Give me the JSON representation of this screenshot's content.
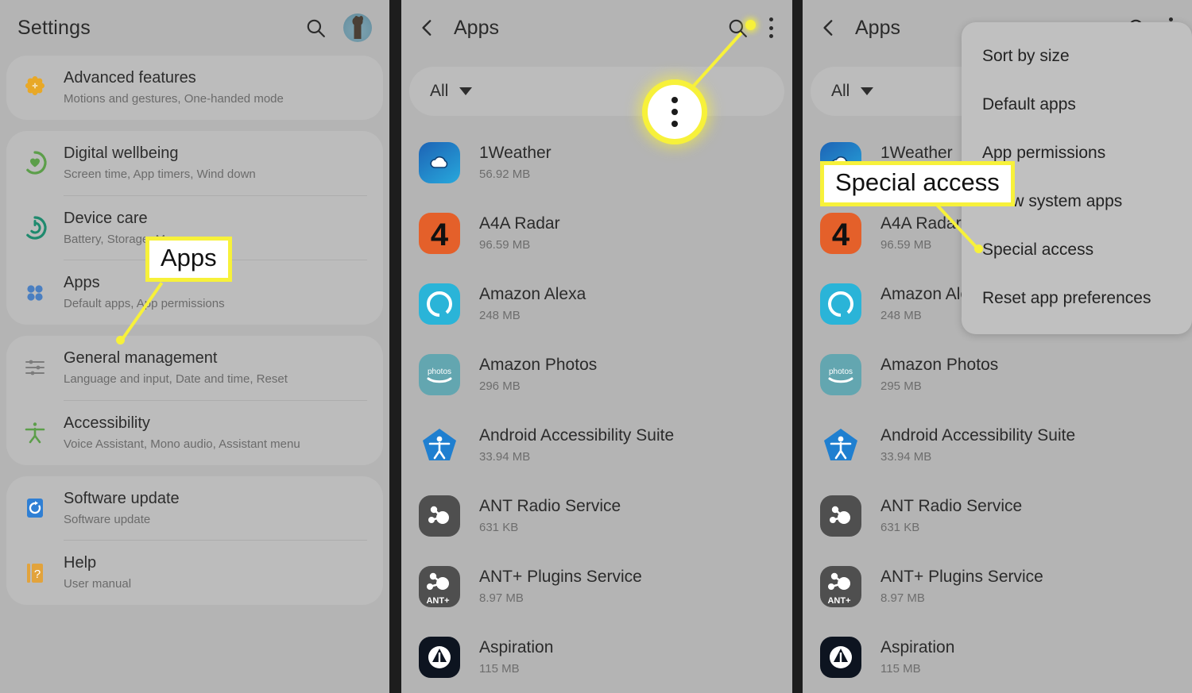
{
  "panels": {
    "settings": {
      "title": "Settings",
      "icons": {
        "search": "search-icon",
        "avatar": "avatar-giraffe"
      },
      "groups": [
        {
          "items": [
            {
              "title": "Advanced features",
              "subtitle": "Motions and gestures, One-handed mode",
              "icon": "advanced-features-icon",
              "color": "#e8a827"
            }
          ]
        },
        {
          "items": [
            {
              "title": "Digital wellbeing",
              "subtitle": "Screen time, App timers, Wind down",
              "icon": "digital-wellbeing-icon",
              "color": "#5c9e4a"
            },
            {
              "title": "Device care",
              "subtitle": "Battery, Storage, Memory",
              "icon": "device-care-icon",
              "color": "#1f8a6e"
            },
            {
              "title": "Apps",
              "subtitle": "Default apps, App permissions",
              "icon": "apps-icon",
              "color": "#4a7fc1"
            }
          ]
        },
        {
          "items": [
            {
              "title": "General management",
              "subtitle": "Language and input, Date and time, Reset",
              "icon": "sliders-icon",
              "color": "#787878"
            },
            {
              "title": "Accessibility",
              "subtitle": "Voice Assistant, Mono audio, Assistant menu",
              "icon": "accessibility-icon",
              "color": "#5c9e4a"
            }
          ]
        },
        {
          "items": [
            {
              "title": "Software update",
              "subtitle": "Software update",
              "icon": "software-update-icon",
              "color": "#2f7fd4"
            },
            {
              "title": "Help",
              "subtitle": "User manual",
              "icon": "help-icon",
              "color": "#e2a33c"
            }
          ]
        }
      ]
    },
    "apps_middle": {
      "title": "Apps",
      "back_icon": "back-chevron-icon",
      "search_icon": "search-icon",
      "menu_icon": "kebab-menu-icon",
      "filter_label": "All",
      "filter_caret": "chevron-down-icon",
      "apps": [
        {
          "name": "1Weather",
          "size": "56.92 MB",
          "icon": "weather-cloud-icon"
        },
        {
          "name": "A4A Radar",
          "size": "96.59 MB",
          "icon": "a4a-radar-icon"
        },
        {
          "name": "Amazon Alexa",
          "size": "248 MB",
          "icon": "alexa-icon"
        },
        {
          "name": "Amazon Photos",
          "size": "296 MB",
          "icon": "amazon-photos-icon"
        },
        {
          "name": "Android Accessibility Suite",
          "size": "33.94 MB",
          "icon": "accessibility-suite-icon"
        },
        {
          "name": "ANT Radio Service",
          "size": "631 KB",
          "icon": "ant-radio-icon"
        },
        {
          "name": "ANT+ Plugins Service",
          "size": "8.97 MB",
          "icon": "ant-plus-icon"
        },
        {
          "name": "Aspiration",
          "size": "115 MB",
          "icon": "aspiration-icon"
        }
      ]
    },
    "apps_right": {
      "title": "Apps",
      "back_icon": "back-chevron-icon",
      "search_icon": "search-icon",
      "menu_icon": "kebab-menu-icon",
      "filter_label": "All",
      "filter_caret": "chevron-down-icon",
      "apps": [
        {
          "name": "1Weather",
          "size": "56.92 MB",
          "icon": "weather-cloud-icon"
        },
        {
          "name": "A4A Radar",
          "size": "96.59 MB",
          "icon": "a4a-radar-icon"
        },
        {
          "name": "Amazon Alexa",
          "size": "248 MB",
          "icon": "alexa-icon"
        },
        {
          "name": "Amazon Photos",
          "size": "295 MB",
          "icon": "amazon-photos-icon"
        },
        {
          "name": "Android Accessibility Suite",
          "size": "33.94 MB",
          "icon": "accessibility-suite-icon"
        },
        {
          "name": "ANT Radio Service",
          "size": "631 KB",
          "icon": "ant-radio-icon"
        },
        {
          "name": "ANT+ Plugins Service",
          "size": "8.97 MB",
          "icon": "ant-plus-icon"
        },
        {
          "name": "Aspiration",
          "size": "115 MB",
          "icon": "aspiration-icon"
        }
      ],
      "menu": {
        "items": [
          "Sort by size",
          "Default apps",
          "App permissions",
          "Show system apps",
          "Special access",
          "Reset app preferences"
        ]
      }
    }
  },
  "annotations": {
    "highlight_color": "#f7f13a",
    "callouts": [
      {
        "label": "Apps",
        "target": "settings-apps-row"
      },
      {
        "label": "Special access",
        "target": "menu-special-access"
      }
    ],
    "markers": [
      {
        "name": "kebab-menu-spotlight",
        "icon": "kebab-menu-icon"
      }
    ]
  }
}
